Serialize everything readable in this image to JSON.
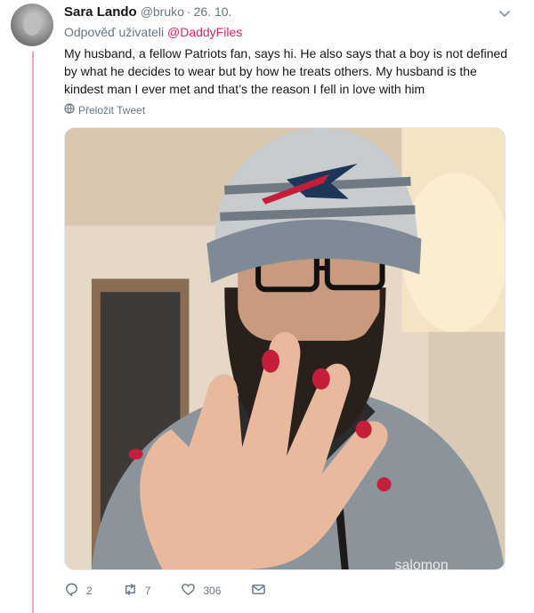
{
  "tweet": {
    "author_name": "Sara Lando",
    "author_handle": "@bruko",
    "separator": "·",
    "date": "26. 10.",
    "reply_prefix": "Odpověď uživateli",
    "reply_to": "@DaddyFiles",
    "text": "My husband, a fellow Patriots fan, says hi. He also says that a boy is not defined by what he decides to wear but by how he treats others. My husband is the kindest man I ever met and that’s the reason I fell in love with him",
    "translate_label": "Přeložit Tweet",
    "image_text": "salomon"
  },
  "actions": {
    "replies": "2",
    "retweets": "7",
    "likes": "306"
  },
  "icons": {
    "caret": "chevron-down-icon",
    "translate": "globe-icon",
    "reply": "reply-icon",
    "retweet": "retweet-icon",
    "like": "heart-icon",
    "dm": "envelope-icon"
  },
  "colors": {
    "thread_line": "#f5a3b0",
    "mention": "#e0245e",
    "secondary_text": "#657786",
    "nail_polish": "#c41e3a"
  }
}
